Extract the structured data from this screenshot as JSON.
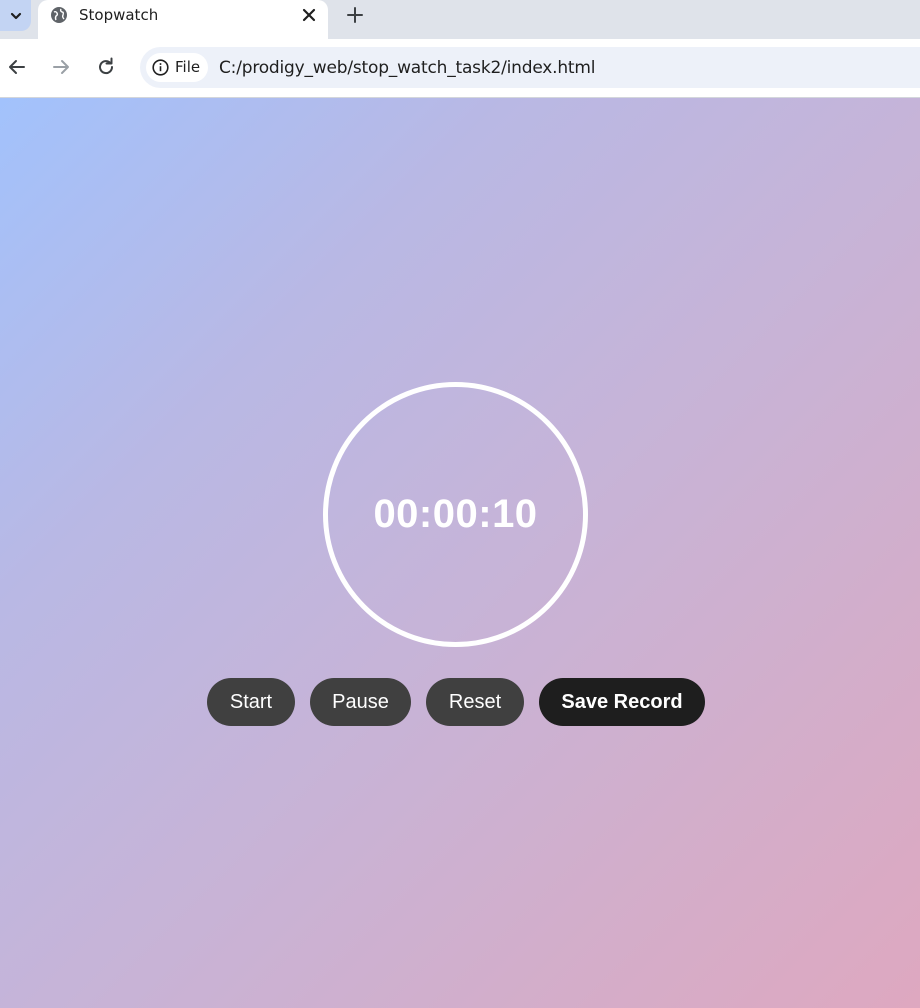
{
  "browser": {
    "tab": {
      "title": "Stopwatch"
    },
    "omnibox": {
      "chip_label": "File",
      "url": "C:/prodigy_web/stop_watch_task2/index.html"
    }
  },
  "stopwatch": {
    "time": "00:00:10",
    "buttons": {
      "start": "Start",
      "pause": "Pause",
      "reset": "Reset",
      "save": "Save Record"
    }
  },
  "colors": {
    "gradient_start": "#a2c2fc",
    "gradient_end": "#dea8c0",
    "button": "#404040",
    "save_button": "#1e1e1e"
  }
}
